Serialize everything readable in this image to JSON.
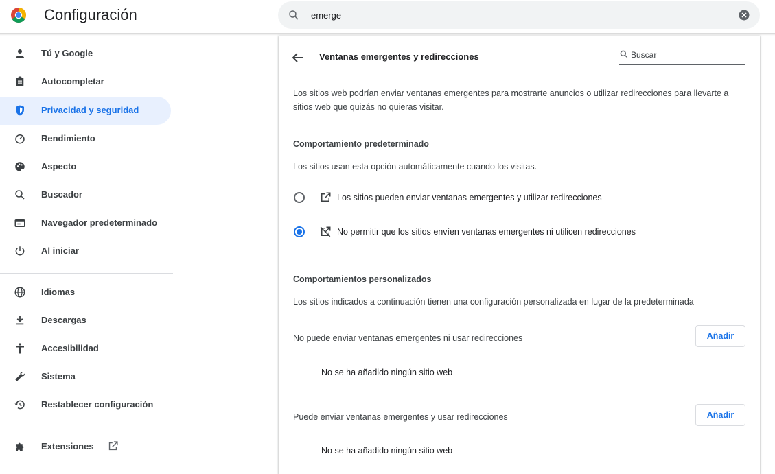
{
  "header": {
    "title": "Configuración",
    "search_value": "emerge",
    "colors": {
      "accent": "#1a73e8",
      "active_bg": "#e8f0fe"
    }
  },
  "sidebar": {
    "items": [
      {
        "label": "Tú y Google",
        "icon": "person-icon"
      },
      {
        "label": "Autocompletar",
        "icon": "clipboard-icon"
      },
      {
        "label": "Privacidad y seguridad",
        "icon": "shield-icon",
        "active": true
      },
      {
        "label": "Rendimiento",
        "icon": "gauge-icon"
      },
      {
        "label": "Aspecto",
        "icon": "palette-icon"
      },
      {
        "label": "Buscador",
        "icon": "search-icon"
      },
      {
        "label": "Navegador predeterminado",
        "icon": "browser-icon"
      },
      {
        "label": "Al iniciar",
        "icon": "power-icon"
      },
      {
        "label": "Idiomas",
        "icon": "globe-icon"
      },
      {
        "label": "Descargas",
        "icon": "download-icon"
      },
      {
        "label": "Accesibilidad",
        "icon": "accessibility-icon"
      },
      {
        "label": "Sistema",
        "icon": "wrench-icon"
      },
      {
        "label": "Restablecer configuración",
        "icon": "restore-icon"
      },
      {
        "label": "Extensiones",
        "icon": "puzzle-icon"
      }
    ]
  },
  "page": {
    "title": "Ventanas emergentes y redirecciones",
    "search_placeholder": "Buscar",
    "description": "Los sitios web podrían enviar ventanas emergentes para mostrarte anuncios o utilizar redirecciones para llevarte a sitios web que quizás no quieras visitar.",
    "default_behavior": {
      "heading": "Comportamiento predeterminado",
      "subtitle": "Los sitios usan esta opción automáticamente cuando los visitas.",
      "options": [
        {
          "label": "Los sitios pueden enviar ventanas emergentes y utilizar redirecciones",
          "icon": "open-in-new-icon",
          "checked": false
        },
        {
          "label": "No permitir que los sitios envíen ventanas emergentes ni utilicen redirecciones",
          "icon": "popup-blocked-icon",
          "checked": true
        }
      ]
    },
    "custom_behavior": {
      "heading": "Comportamientos personalizados",
      "subtitle": "Los sitios indicados a continuación tienen una configuración personalizada en lugar de la predeterminada",
      "lists": [
        {
          "label": "No puede enviar ventanas emergentes ni usar redirecciones",
          "button": "Añadir",
          "empty": "No se ha añadido ningún sitio web"
        },
        {
          "label": "Puede enviar ventanas emergentes y usar redirecciones",
          "button": "Añadir",
          "empty": "No se ha añadido ningún sitio web"
        }
      ]
    }
  }
}
